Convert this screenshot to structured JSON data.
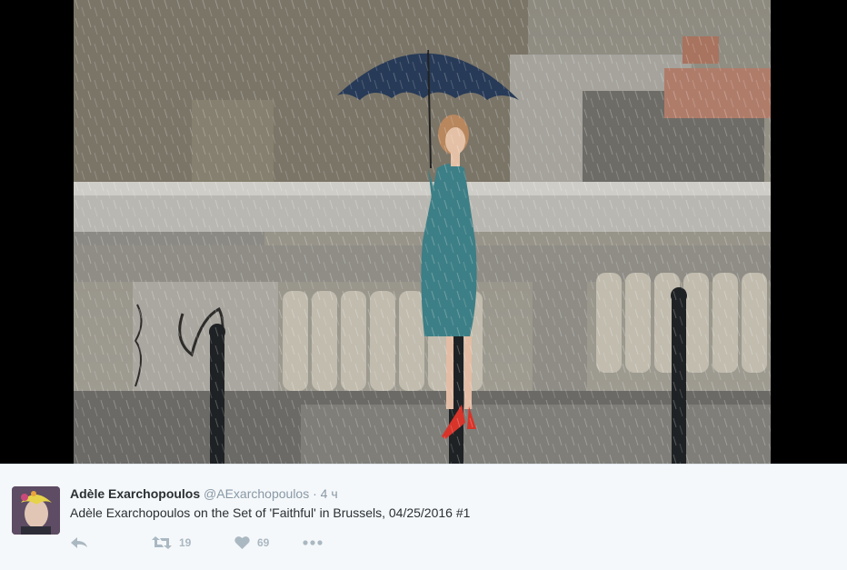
{
  "tweet": {
    "fullname": "Adèle Exarchopoulos",
    "username": "@AExarchopoulos",
    "separator": "·",
    "time": "4 ч",
    "text": "Adèle Exarchopoulos on the Set of 'Faithful' in Brussels, 04/25/2016 #1",
    "retweet_count": "19",
    "like_count": "69"
  },
  "icons": {
    "reply": "reply-icon",
    "retweet": "retweet-icon",
    "like": "heart-icon",
    "more": "more-icon"
  },
  "colors": {
    "background": "#f5f8fa",
    "name": "#292f33",
    "muted": "#8899a6",
    "action": "#aab8c2"
  }
}
